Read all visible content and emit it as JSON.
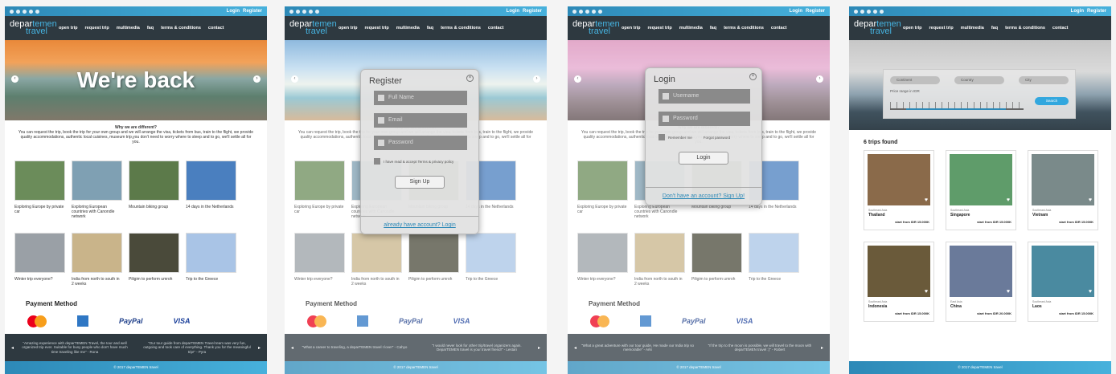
{
  "site": {
    "logo_a": "depar",
    "logo_b": "temen",
    "logo_c": "travel",
    "login": "Login",
    "register": "Register",
    "nav": [
      "open trip",
      "request trip",
      "multimedia",
      "faq",
      "terms & conditions",
      "contact"
    ]
  },
  "hero": {
    "title": "We're back"
  },
  "why": {
    "title": "Why we are different?",
    "body": "You can request the trip, book the trip for your own group and we will arrange the visa, tickets from bus, train to the flight, we provide quality accommodations, authentic local cuisines, museum trip,you don't need to worry where to sleep and to go, we'll settle all for you."
  },
  "trips": [
    {
      "caption": "Exploring Europe by private car",
      "color": "#6b8c5a"
    },
    {
      "caption": "Exploring European countries with Canondle network",
      "color": "#7fa0b3"
    },
    {
      "caption": "Mountain biking group",
      "color": "#5c7a4a"
    },
    {
      "caption": "14 days in the Netherlands",
      "color": "#4a7fbf"
    },
    {
      "caption": "Winter trip everyone?",
      "color": "#9aa0a6"
    },
    {
      "caption": "India from north to south in 2 weeks",
      "color": "#c9b48a"
    },
    {
      "caption": "Piligim to perform umroh",
      "color": "#4a4a3a"
    },
    {
      "caption": "Trip to the Greece",
      "color": "#a9c4e6"
    }
  ],
  "payment": {
    "title": "Payment Method",
    "paypal": "PayPal",
    "visa": "VISA"
  },
  "testimonials": {
    "p1a": "\"Amazing experience with deparTEMEN Travel, the tour and well organized trip ever. Suitable for busy people who don't have much time traveling like me\" - Rona",
    "p1b": "\"Our tour guide from deparTEMEN Travel team was very fun, outgoing and took care of everything. Thank you for the meaningful trip!\" - Pyra",
    "p2": "\"What a career to traveling, a deparTEMEN travel I love!\" - Cahyo",
    "p2b": "\"I would never look for other trip/travel organizers again. DeparTEMEN travel is your travel friend!\" - Lestari",
    "p3a": "\"What a great adventure with our tour guide, He made our India trip so memorable\" - Arki",
    "p3b": "\"If the trip to the moon is possible, we will travel to the moon with deparTEMEN travel :)\" - Robert"
  },
  "footer": {
    "copy": "© 2017 deparTEMEN travel"
  },
  "register": {
    "title": "Register",
    "name_ph": "Full Name",
    "email_ph": "Email",
    "pass_ph": "Password",
    "agree": "I have read & accept Terms & privacy policy",
    "agree_link": "Terms & privacy policy",
    "submit": "Sign Up",
    "switch": "already have account? Login"
  },
  "login": {
    "title": "Login",
    "user_ph": "Username",
    "pass_ph": "Password",
    "remember": "Remember me",
    "forgot": "Forgot password",
    "submit": "Login",
    "switch": "Don't have an account? Sign Up!"
  },
  "search": {
    "continent": "Continent",
    "country": "Country",
    "city": "City",
    "price_label": "Price range in IDR",
    "button": "Search",
    "found": "6 trips found"
  },
  "results": [
    {
      "region": "Southeast Asia",
      "country": "Thailand",
      "price": "start from IDR 15.000K",
      "color": "#8a6a4a"
    },
    {
      "region": "Southeast Asia",
      "country": "Singapore",
      "price": "start from IDR 15.000K",
      "color": "#5f9c6a"
    },
    {
      "region": "Southeast Asia",
      "country": "Vietnam",
      "price": "start from IDR 15.000K",
      "color": "#7a8a8a"
    },
    {
      "region": "Southeast Asia",
      "country": "Indonesia",
      "price": "start from IDR 15.000K",
      "color": "#6a5a3a"
    },
    {
      "region": "East Asia",
      "country": "China",
      "price": "start from IDR 20.000K",
      "color": "#6a7a9a"
    },
    {
      "region": "Southeast Asia",
      "country": "Laos",
      "price": "start from IDR 15.000K",
      "color": "#4a8aa0"
    }
  ]
}
